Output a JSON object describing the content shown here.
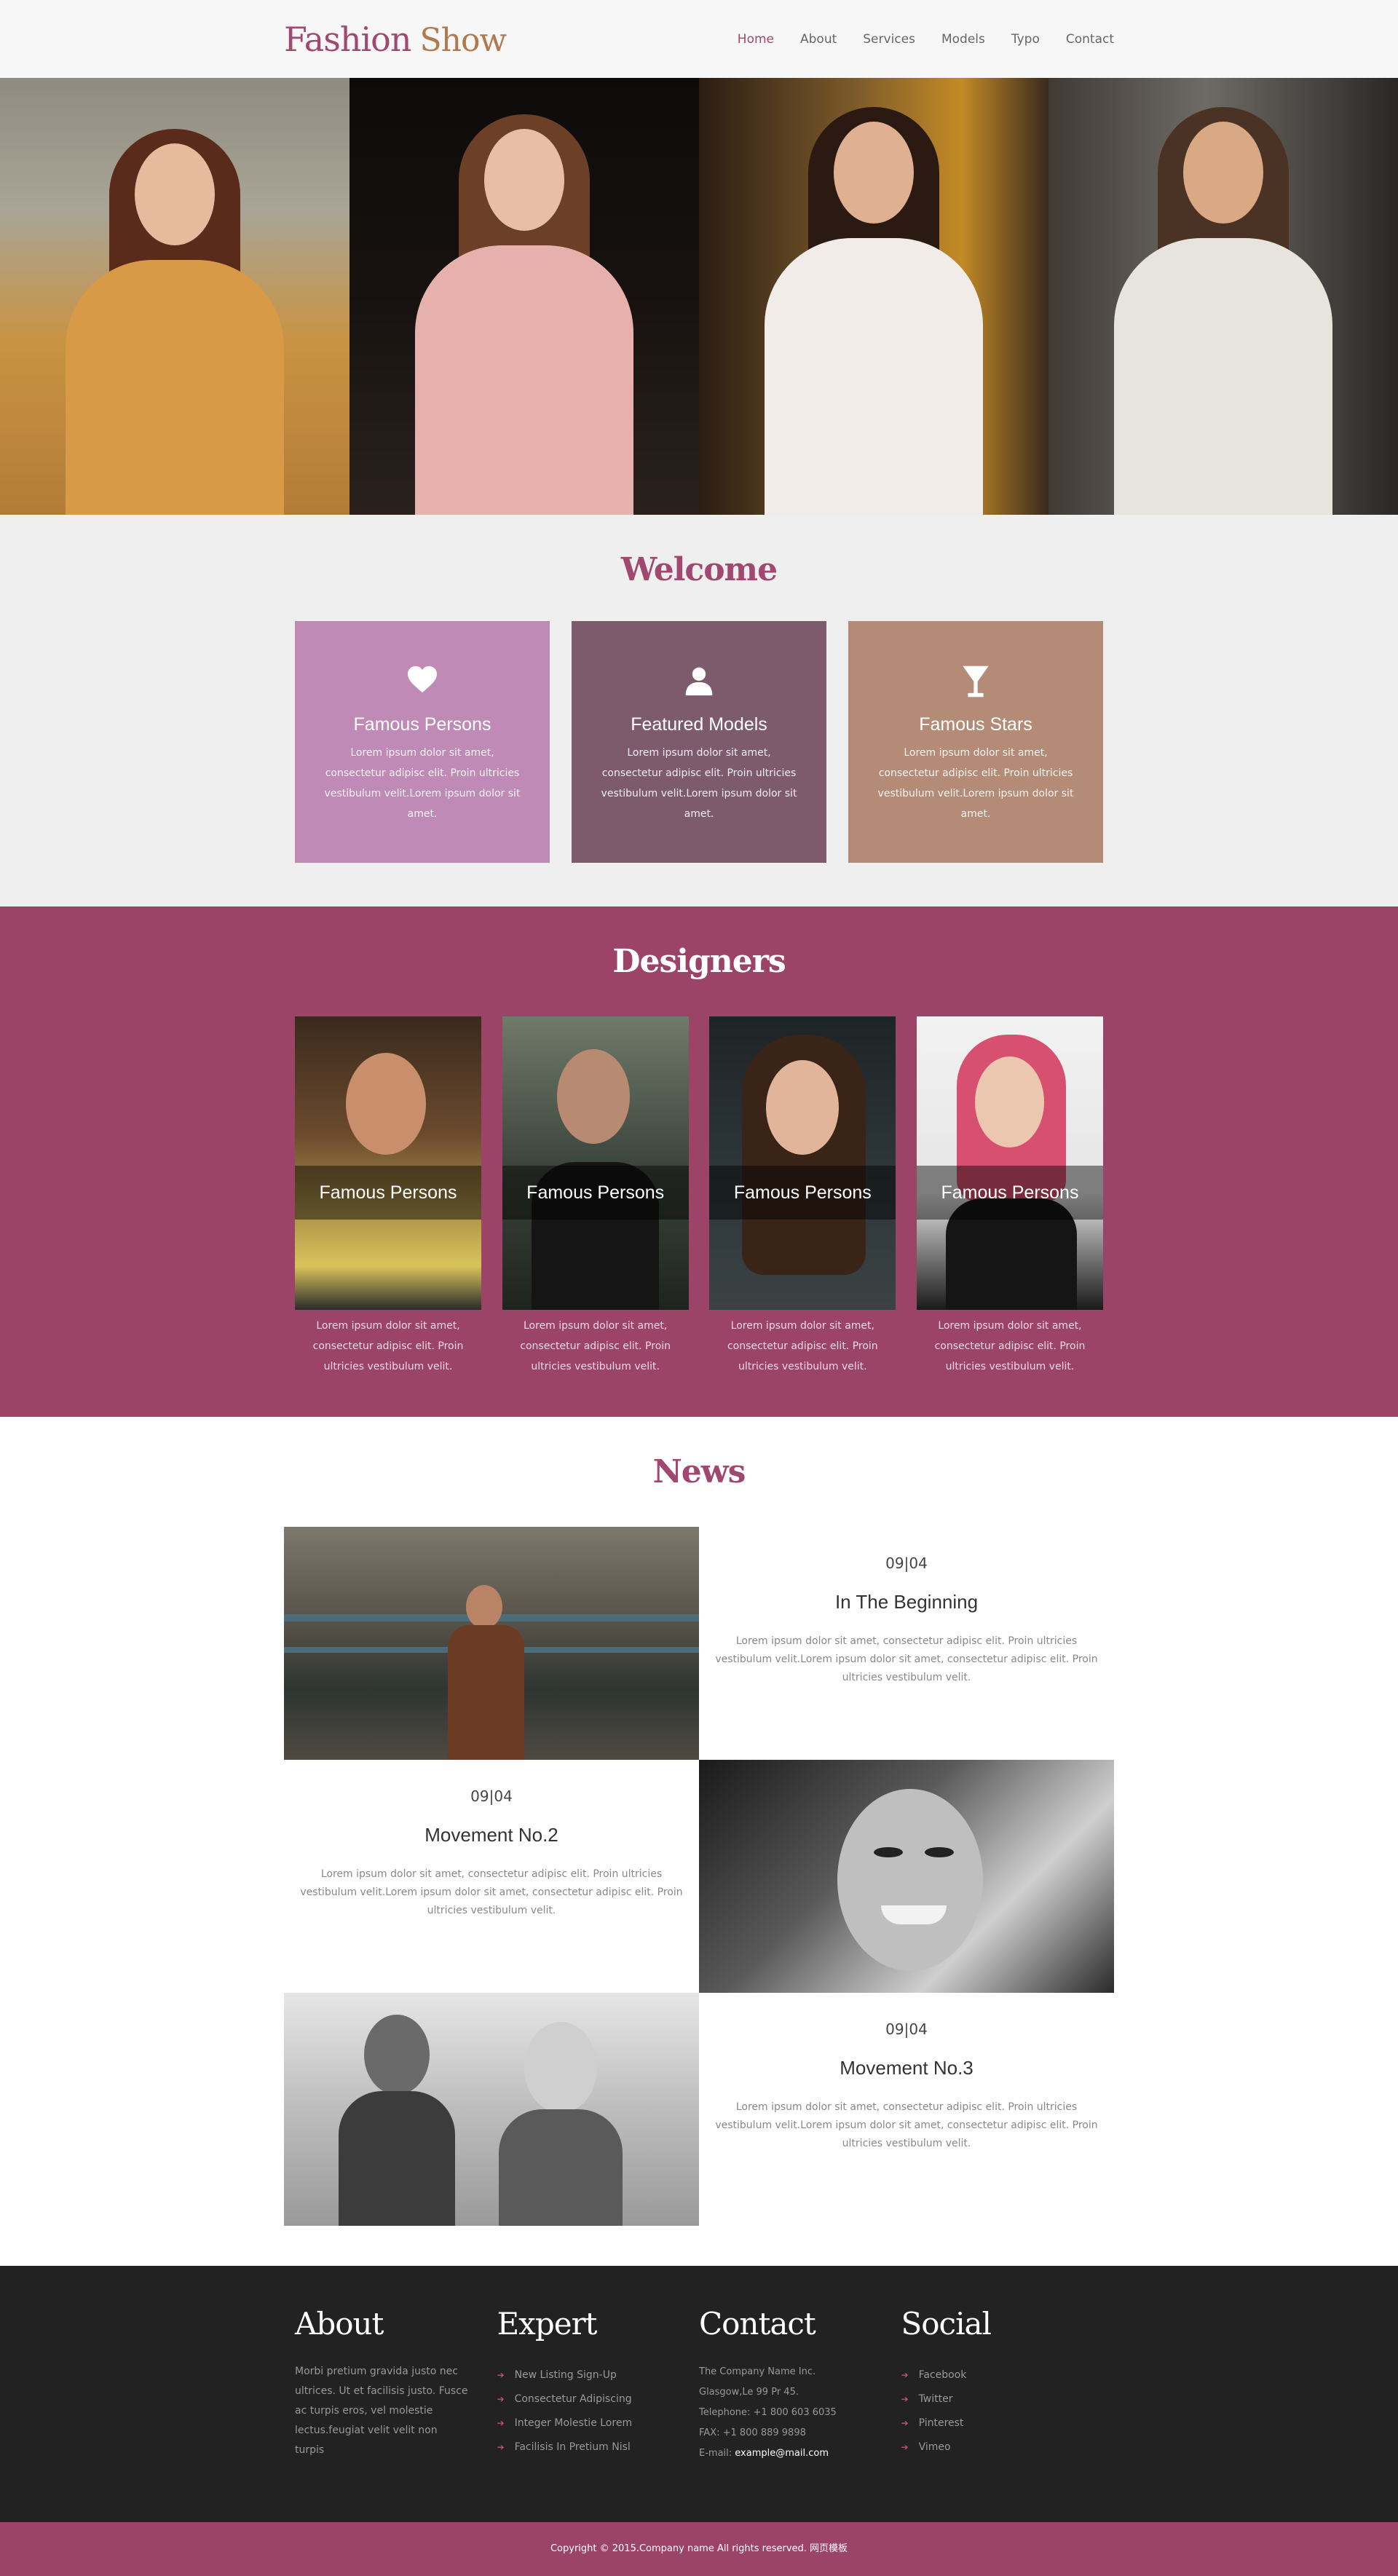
{
  "header": {
    "logo_word1": "Fashion",
    "logo_word2": "Show",
    "nav": [
      "Home",
      "About",
      "Services",
      "Models",
      "Typo",
      "Contact"
    ],
    "active_nav": "Home"
  },
  "welcome": {
    "title": "Welcome",
    "boxes": [
      {
        "icon": "heart-icon",
        "title": "Famous Persons",
        "text": "Lorem ipsum dolor sit amet, consectetur adipisc elit. Proin ultricies vestibulum velit.Lorem ipsum dolor sit amet.",
        "color": "#bf8ab5"
      },
      {
        "icon": "user-icon",
        "title": "Featured Models",
        "text": "Lorem ipsum dolor sit amet, consectetur adipisc elit. Proin ultricies vestibulum velit.Lorem ipsum dolor sit amet.",
        "color": "#7e5a6d"
      },
      {
        "icon": "glass-icon",
        "title": "Famous Stars",
        "text": "Lorem ipsum dolor sit amet, consectetur adipisc elit. Proin ultricies vestibulum velit.Lorem ipsum dolor sit amet.",
        "color": "#b48b77"
      }
    ]
  },
  "designers": {
    "title": "Designers",
    "cards": [
      {
        "caption": "Famous Persons",
        "text": "Lorem ipsum dolor sit amet, consectetur adipisc elit. Proin ultricies vestibulum velit."
      },
      {
        "caption": "Famous Persons",
        "text": "Lorem ipsum dolor sit amet, consectetur adipisc elit. Proin ultricies vestibulum velit."
      },
      {
        "caption": "Famous Persons",
        "text": "Lorem ipsum dolor sit amet, consectetur adipisc elit. Proin ultricies vestibulum velit."
      },
      {
        "caption": "Famous Persons",
        "text": "Lorem ipsum dolor sit amet, consectetur adipisc elit. Proin ultricies vestibulum velit."
      }
    ]
  },
  "news": {
    "title": "News",
    "items": [
      {
        "date": "09|04",
        "title": "In The Beginning",
        "text": "Lorem ipsum dolor sit amet, consectetur adipisc elit. Proin ultricies vestibulum velit.Lorem ipsum dolor sit amet, consectetur adipisc elit. Proin ultricies vestibulum velit."
      },
      {
        "date": "09|04",
        "title": "Movement No.2",
        "text": "Lorem ipsum dolor sit amet, consectetur adipisc elit. Proin ultricies vestibulum velit.Lorem ipsum dolor sit amet, consectetur adipisc elit. Proin ultricies vestibulum velit."
      },
      {
        "date": "09|04",
        "title": "Movement No.3",
        "text": "Lorem ipsum dolor sit amet, consectetur adipisc elit. Proin ultricies vestibulum velit.Lorem ipsum dolor sit amet, consectetur adipisc elit. Proin ultricies vestibulum velit."
      }
    ]
  },
  "footer": {
    "about": {
      "title": "About",
      "text": "Morbi pretium gravida justo nec ultrices. Ut et facilisis justo. Fusce ac turpis eros, vel molestie lectus.feugiat velit velit non turpis"
    },
    "expert": {
      "title": "Expert",
      "items": [
        "New Listing Sign-Up",
        "Consectetur Adipiscing",
        "Integer Molestie Lorem",
        "Facilisis In Pretium Nisl"
      ]
    },
    "contact": {
      "title": "Contact",
      "company": "The Company Name Inc.",
      "address": "Glasgow,Le 99 Pr 45.",
      "telephone": "Telephone: +1 800 603 6035",
      "fax": "FAX: +1 800 889 9898",
      "email_label": "E-mail:",
      "email": "example@mail.com"
    },
    "social": {
      "title": "Social",
      "items": [
        "Facebook",
        "Twitter",
        "Pinterest",
        "Vimeo"
      ]
    },
    "copyright": "Copyright © 2015.Company name All rights reserved. 网页模板"
  },
  "colors": {
    "accent": "#9c4467",
    "logo_secondary": "#b07a4e",
    "footer_bg": "#222222"
  }
}
